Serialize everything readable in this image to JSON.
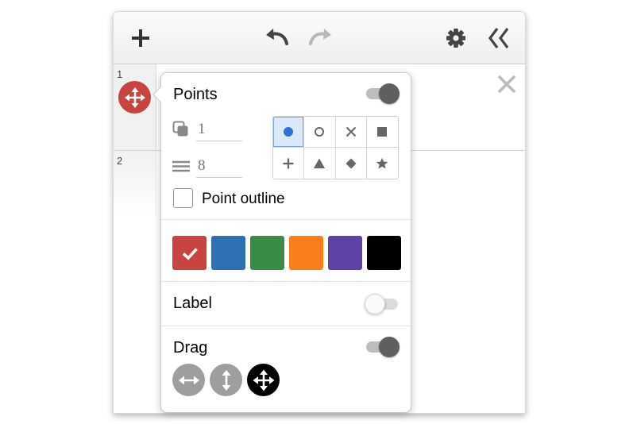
{
  "toolbar": {
    "icons": {
      "add": "plus-icon",
      "undo": "undo-icon",
      "redo": "redo-icon",
      "settings": "gear-icon",
      "collapse": "double-chevron-left-icon"
    }
  },
  "expressions": [
    {
      "index": "1",
      "color": "#c74440"
    },
    {
      "index": "2"
    }
  ],
  "style_popover": {
    "points": {
      "title": "Points",
      "enabled": true,
      "opacity_value": "1",
      "size_value": "8",
      "shapes": [
        "circle-filled",
        "circle-open",
        "cross",
        "square",
        "plus",
        "triangle",
        "diamond",
        "star"
      ],
      "selected_shape": "circle-filled",
      "outline_label": "Point outline",
      "outline_checked": false
    },
    "colors": {
      "swatches": [
        "#c74440",
        "#2d70b3",
        "#388c46",
        "#fa7e19",
        "#6042a6",
        "#000000"
      ],
      "selected": "#c74440"
    },
    "label": {
      "title": "Label",
      "enabled": false
    },
    "drag": {
      "title": "Drag",
      "enabled": true,
      "options": [
        "horizontal",
        "vertical",
        "both"
      ],
      "selected": "both"
    }
  }
}
